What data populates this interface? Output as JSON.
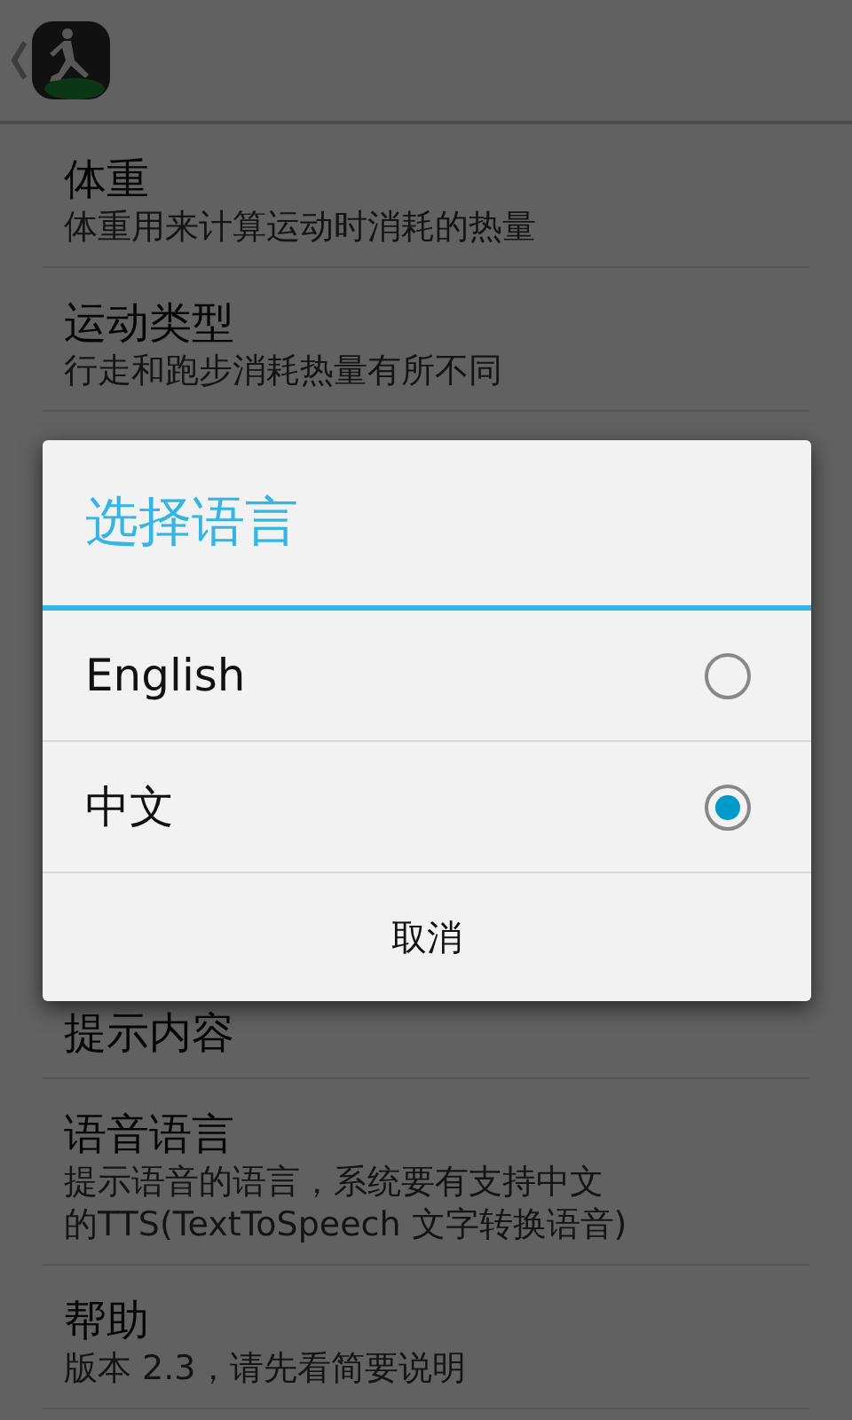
{
  "settings": [
    {
      "title": "体重",
      "summary": [
        "体重用来计算运动时消耗的热量"
      ]
    },
    {
      "title": "运动类型",
      "summary": [
        "行走和跑步消耗热量有所不同"
      ]
    },
    {
      "title": "提示内容"
    },
    {
      "title": "语音语言",
      "summary": [
        "提示语音的语言，系统要有支持中文",
        "的TTS(TextToSpeech 文字转换语音)"
      ]
    },
    {
      "title": "帮助",
      "summary": [
        "版本 2.3，请先看简要说明"
      ]
    }
  ],
  "dialog": {
    "title": "选择语言",
    "options": [
      {
        "label": "English",
        "selected": false
      },
      {
        "label": "中文",
        "selected": true
      }
    ],
    "cancel": "取消"
  }
}
